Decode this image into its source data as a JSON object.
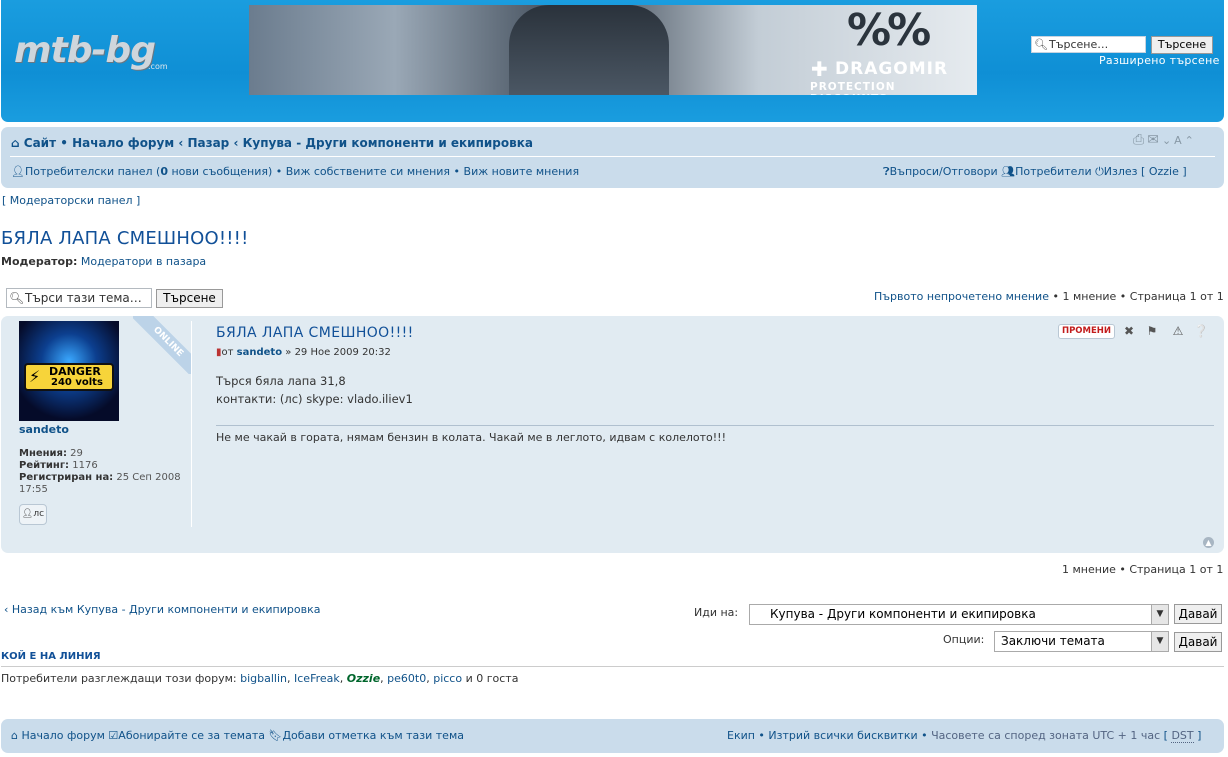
{
  "header": {
    "logo_text": "mtb-bg",
    "logo_sub": ".com",
    "banner": {
      "percent": "%%",
      "brand": "DRAGOMIR",
      "tagline": "PROTECTION DISCOUNTS"
    },
    "search_placeholder": "Търсене…",
    "search_button": "Търсене",
    "advanced_search": "Разширено търсене"
  },
  "breadcrumbs": {
    "site": "Сайт",
    "forum_index": "Начало форум",
    "market": "Пазар",
    "category": "Купува - Други компоненти и екипировка"
  },
  "userbar": {
    "control_panel": "Потребителски панел",
    "new_messages_count": "0",
    "new_messages_label": "нови съобщения",
    "own_posts": "Виж собствените си мнения",
    "new_posts": "Виж новите мнения",
    "faq": "Въпроси/Отговори",
    "members": "Потребители",
    "logout": "Излез",
    "username": "Ozzie"
  },
  "mod_panel": "Модераторски панел",
  "topic": {
    "title": "БЯЛА ЛАПА СМЕШНОО!!!!",
    "moderator_label": "Модератор:",
    "moderator_value": "Модератори в пазара",
    "search_placeholder": "Търси тази тема…",
    "search_button": "Търсене",
    "first_unread": "Първото непрочетено мнение",
    "pagination": "1 мнение • Страница 1 от 1"
  },
  "post": {
    "online_badge": "ONLINE",
    "avatar_text_1": "DANGER",
    "avatar_text_2": "240 volts",
    "author": "sandeto",
    "stats": {
      "posts_label": "Мнения:",
      "posts_value": "29",
      "rating_label": "Рейтинг:",
      "rating_value": "1176",
      "registered_label": "Регистриран на:",
      "registered_value": "25 Сеп 2008 17:55"
    },
    "pm_button": "лс",
    "title": "БЯЛА ЛАПА СМЕШНОО!!!!",
    "by_label": "от",
    "date": "» 29 Ное 2009 20:32",
    "body_line_1": "Търся бяла лапа 31,8",
    "body_line_2": "контакти: (лс) skype: vlado.iliev1",
    "signature": "Не ме чакай в гората, нямам бензин в колата. Чакай ме в леглото, идвам с колелото!!!",
    "edit_button": "ПРОМЕНИ"
  },
  "bottom": {
    "pagination": "1 мнение • Страница 1 от 1",
    "back_link": "Назад към Купува - Други компоненти и екипировка",
    "jump_label": "Иди на:",
    "jump_value": "Купува - Други компоненти и екипировка",
    "go_button": "Давай",
    "options_label": "Опции:",
    "options_value": "Заключи темата"
  },
  "online": {
    "title": "КОЙ Е НА ЛИНИЯ",
    "prefix": "Потребители разглеждащи този форум:",
    "users": [
      "bigballin",
      "IceFreak",
      "Ozzie",
      "pe60t0",
      "picco"
    ],
    "suffix": "и 0 госта"
  },
  "footer": {
    "forum_index": "Начало форум",
    "subscribe": "Абонирайте се за темата",
    "bookmark": "Добави отметка към тази тема",
    "team": "Екип",
    "delete_cookies": "Изтрий всички бисквитки",
    "timezone": "Часовете са според зоната UTC + 1 час",
    "dst": "DST"
  },
  "colors": {
    "header_blue": "#1a9ddf",
    "nav_blue": "#cadceb",
    "post_bg": "#e1ebf2",
    "link": "#105289",
    "title": "#115098"
  }
}
